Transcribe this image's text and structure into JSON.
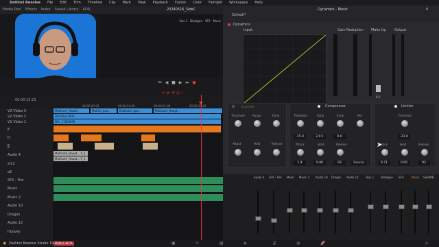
{
  "menu": {
    "app_name": "DaVinci Resolve",
    "items": [
      "File",
      "Edit",
      "Trim",
      "Timeline",
      "Clip",
      "Mark",
      "View",
      "Playback",
      "Fusion",
      "Color",
      "Fairlight",
      "Workspace",
      "Help"
    ]
  },
  "project_title": "20240516_SideC",
  "toolbar": {
    "items": [
      "Media Pool",
      "Effects",
      "Index",
      "Sound Library",
      "ADR"
    ],
    "mixer_tabs": [
      "Bus 1",
      "Dialogue",
      "SFX",
      "Music",
      "SideWB"
    ]
  },
  "timeline": {
    "timecode": "00:00:15:23",
    "ruler": [
      "00:00:07:00",
      "00:00:14:00",
      "00:00:21:00",
      "00:00:28:00"
    ],
    "tracks": [
      "V3",
      "V2",
      "V1",
      "K",
      "D",
      "E",
      "L",
      "Audio 4",
      "sfx1",
      "a5",
      "SFX - Fire",
      "Music",
      "Music 2",
      "Audio 10",
      "Dragon",
      "Audio 12",
      "Hooves"
    ],
    "track_titles": [
      "Video 3",
      "Video 2",
      "Video 1"
    ],
    "clips": [
      "Multicam_Haubi...",
      "Multics_goo...",
      "Multicam_goo...",
      "Multicam_Haupt...",
      "DRIVELLI.MOV",
      "DFL_1728.MP4",
      "Multicam_Haupt... V_1",
      "Multicam_Haupt... V_1"
    ]
  },
  "dynamics": {
    "preset": "Default*",
    "title": "Dynamics - Music",
    "section_label": "Dynamics",
    "columns": [
      "Input",
      "Gain Reduction",
      "Make Up",
      "Output"
    ],
    "makeup_value": "0.0",
    "compressor": {
      "label": "Compressor",
      "threshold": "-15.0",
      "ratio": "2.0:1",
      "knee": "0.0",
      "attack": "1.4",
      "hold": "0.00",
      "release": "93",
      "source": "Source"
    },
    "limiter": {
      "label": "Limiter",
      "threshold": "-21.0",
      "attack": "0.71",
      "hold": "0.00",
      "release": "93"
    },
    "expander": {
      "threshold_label": "Threshold",
      "range_label": "Range",
      "ratio_label": "Ratio",
      "attack_label": "Attack",
      "hold_label": "Hold",
      "release_label": "Release",
      "sidechain_label": "Expander"
    },
    "knob_labels": {
      "threshold": "Threshold",
      "ratio": "Ratio",
      "knee": "Knee",
      "mix": "Mix",
      "attack": "Attack",
      "hold": "Hold",
      "release": "Release"
    }
  },
  "mixer": {
    "strips": [
      "Audio 6",
      "SFX - Fire",
      "Music",
      "Music 2",
      "Audio 10",
      "Dragon",
      "Audio 12",
      "Bus 1",
      "Dialogue",
      "SFX",
      "Music",
      "SideWB"
    ]
  },
  "status": {
    "app": "DaVinci Resolve Studio 19",
    "badge": "PUBLIC BETA"
  },
  "colors": {
    "accent_red": "#e23b3b",
    "clip_blue": "#3c8fd6",
    "clip_orange": "#e5771f",
    "clip_tan": "#c9b28a",
    "clip_green": "#2f8d5a",
    "webcam_bg": "#1b75d6"
  }
}
